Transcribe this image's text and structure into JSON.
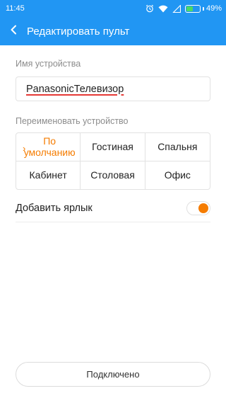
{
  "status_bar": {
    "time": "11:45",
    "battery_percent": "49%",
    "battery_level": 0.49,
    "icons": [
      "alarm-icon",
      "wifi-icon",
      "signal-icon",
      "battery-icon"
    ]
  },
  "app_bar": {
    "back_icon": "chevron-left-icon",
    "title": "Редактировать пульт"
  },
  "device_name": {
    "label": "Имя устройства",
    "value": "PanasonicТелевизор"
  },
  "rename": {
    "label": "Переименовать устройство",
    "options": [
      {
        "label": "По умолчанию",
        "selected": true
      },
      {
        "label": "Гостиная",
        "selected": false
      },
      {
        "label": "Спальня",
        "selected": false
      },
      {
        "label": "Кабинет",
        "selected": false
      },
      {
        "label": "Столовая",
        "selected": false
      },
      {
        "label": "Офис",
        "selected": false
      }
    ]
  },
  "shortcut": {
    "label": "Добавить ярлык",
    "enabled": true
  },
  "connect_button": {
    "label": "Подключено"
  },
  "colors": {
    "primary": "#2196F3",
    "accent": "#F57C00",
    "battery": "#4CD964"
  }
}
